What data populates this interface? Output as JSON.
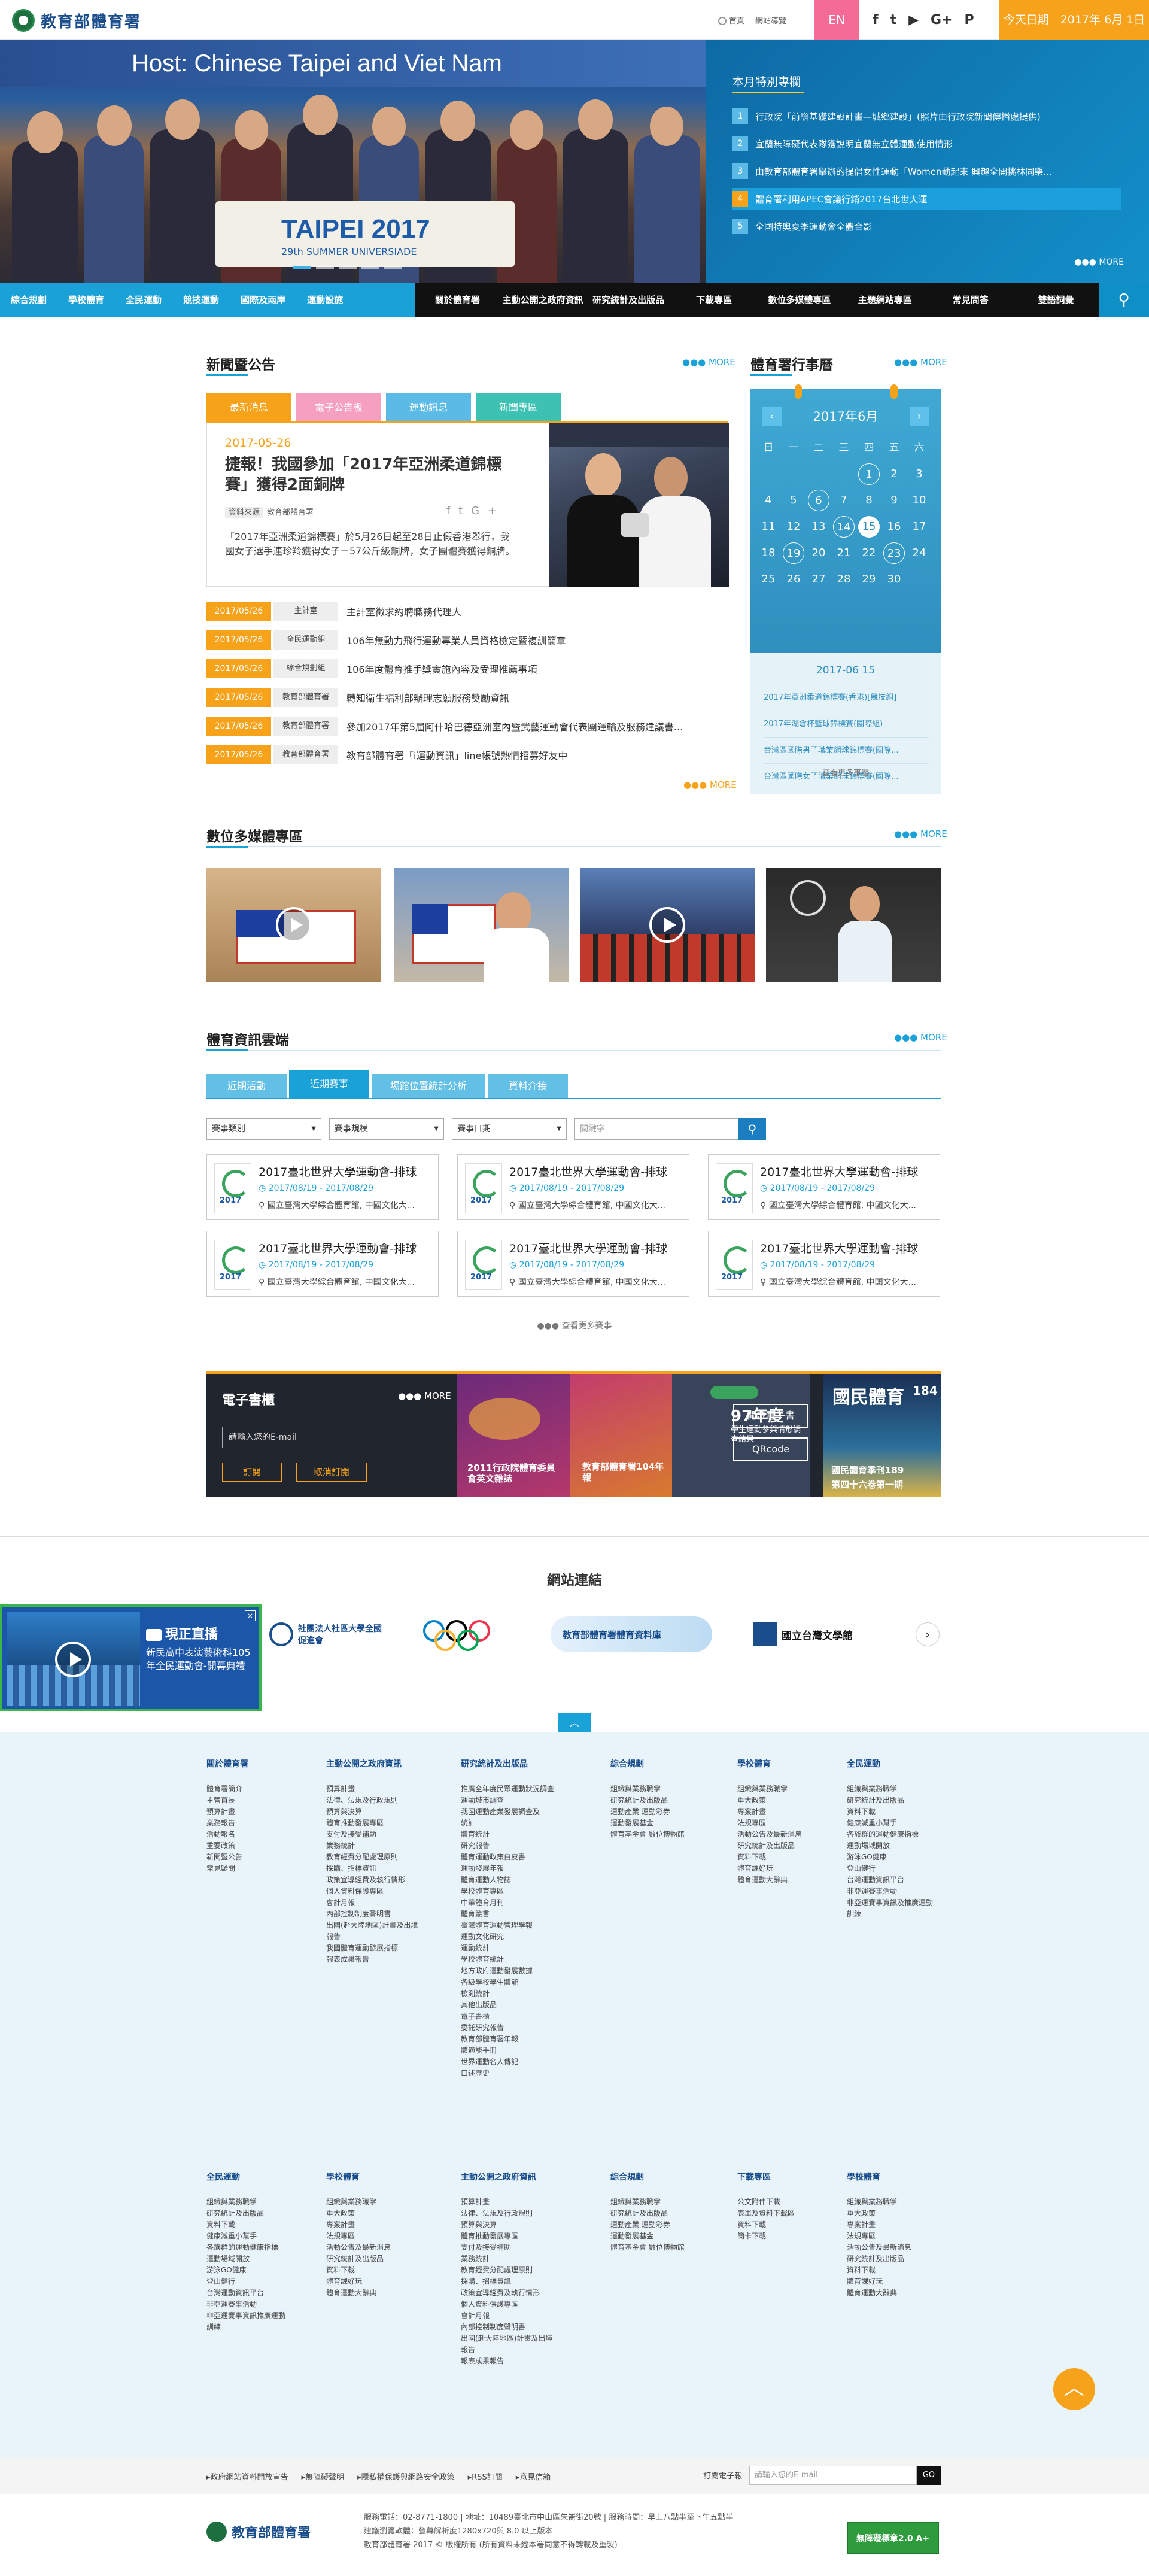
{
  "header": {
    "site_name": "教育部體育署",
    "links": [
      "首頁",
      "網站導覽"
    ],
    "lang": "EN",
    "social": [
      "f",
      "t",
      "▶",
      "G+",
      "P"
    ],
    "today": "今天日期　2017年 6月 1日"
  },
  "hero": {
    "sign_text": "Host: Chinese Taipei and Viet Nam",
    "banner_text": "TAIPEI 2017",
    "banner_sub": "29th SUMMER UNIVERSIADE",
    "special_title": "本月特別專欄",
    "special_items": [
      {
        "num": "1",
        "text": "行政院「前瞻基礎建設計畫—城鄉建設」(照片由行政院新聞傳播處提供)"
      },
      {
        "num": "2",
        "text": "宜蘭無障礙代表隊獲說明宜蘭無立體運動使用情形"
      },
      {
        "num": "3",
        "text": "由教育部體育署舉辦的提倡女性運動「Women動起來 興趣全開挑林同樂..."
      },
      {
        "num": "4",
        "text": "體育署利用APEC會議行銷2017台北世大運"
      },
      {
        "num": "5",
        "text": "全國特奧夏季運動會全體合影"
      }
    ],
    "special_more": "●●● MORE"
  },
  "nav": {
    "primary": [
      "綜合規劃",
      "學校體育",
      "全民運動",
      "競技運動",
      "國際及兩岸",
      "運動設施"
    ],
    "secondary": [
      "關於體育署",
      "主動公開之政府資訊",
      "研究統計及出版品",
      "下載專區",
      "數位多媒體專區",
      "主題網站專區",
      "常見問答",
      "雙語詞彙"
    ],
    "search_icon": "search-icon"
  },
  "news": {
    "title": "新聞暨公告",
    "more": "●●● MORE",
    "tabs": [
      {
        "label": "最新消息",
        "color": "#f7a21b"
      },
      {
        "label": "電子公告板",
        "color": "#f6a0c0"
      },
      {
        "label": "運動訊息",
        "color": "#5bbbe6"
      },
      {
        "label": "新聞專區",
        "color": "#3cc1b2"
      }
    ],
    "feature": {
      "date": "2017-05-26",
      "title": "捷報！我國參加「2017年亞洲柔道錦標賽」獲得2面銅牌",
      "tag": "資料來源",
      "source": "教育部體育署",
      "summary": "「2017年亞洲柔道錦標賽」於5月26日起至28日止假香港舉行，我國女子選手連珍羚獲得女子－57公斤級銅牌，女子團體賽獲得銅牌。"
    },
    "items": [
      {
        "date": "2017/05/26",
        "cat": "主計室",
        "text": "主計室徵求約聘職務代理人"
      },
      {
        "date": "2017/05/26",
        "cat": "全民運動組",
        "text": "106年無動力飛行運動專業人員資格檢定暨複訓簡章"
      },
      {
        "date": "2017/05/26",
        "cat": "綜合規劃組",
        "text": "106年度體育推手獎實施內容及受理推薦事項"
      },
      {
        "date": "2017/05/26",
        "cat": "教育部體育署",
        "text": "轉知衛生福利部辦理志願服務獎勵資訊"
      },
      {
        "date": "2017/05/26",
        "cat": "教育部體育署",
        "text": "參加2017年第5屆阿什哈巴德亞洲室內暨武藝運動會代表團運輸及服務建議書..."
      },
      {
        "date": "2017/05/26",
        "cat": "教育部體育署",
        "text": "教育部體育署「i運動資訊」line帳號熱情招募好友中"
      }
    ],
    "bottom_more": "●●● MORE"
  },
  "calendar": {
    "title": "體育署行事曆",
    "more": "●●● MORE",
    "month": "2017年6月",
    "weekdays": [
      "日",
      "一",
      "二",
      "三",
      "四",
      "五",
      "六"
    ],
    "days": [
      "",
      "",
      "",
      "",
      "1",
      "2",
      "3",
      "4",
      "5",
      "6",
      "7",
      "8",
      "9",
      "10",
      "11",
      "12",
      "13",
      "14",
      "15",
      "16",
      "17",
      "18",
      "19",
      "20",
      "21",
      "22",
      "23",
      "24",
      "25",
      "26",
      "27",
      "28",
      "29",
      "30",
      ""
    ],
    "circled": [
      "1",
      "6",
      "14",
      "19",
      "23"
    ],
    "today": "15",
    "selected_date": "2017-06 15",
    "events": [
      "2017年亞洲柔道錦標賽(香港)[競技組]",
      "2017年湖倉杯籃球錦標賽(國際組)",
      "台灣區國際男子職業網球錦標賽(國際...",
      "台灣區國際女子職業網球錦標賽(國際..."
    ],
    "see_more": "查看更多事曆"
  },
  "media": {
    "title": "數位多媒體專區",
    "more": "●●● MORE"
  },
  "sports_info": {
    "title": "體育資訊雲端",
    "more": "●●● MORE",
    "tabs": [
      "近期活動",
      "近期賽事",
      "場館位置統計分析",
      "資料介接"
    ],
    "filters": [
      "賽事類別",
      "賽事規模",
      "賽事日期"
    ],
    "keyword_placeholder": "關鍵字",
    "events": [
      {
        "title": "2017臺北世界大學運動會-排球",
        "date": "2017/08/19 - 2017/08/29",
        "place": "國立臺灣大學綜合體育館, 中國文化大..."
      },
      {
        "title": "2017臺北世界大學運動會-排球",
        "date": "2017/08/19 - 2017/08/29",
        "place": "國立臺灣大學綜合體育館, 中國文化大..."
      },
      {
        "title": "2017臺北世界大學運動會-排球",
        "date": "2017/08/19 - 2017/08/29",
        "place": "國立臺灣大學綜合體育館, 中國文化大..."
      },
      {
        "title": "2017臺北世界大學運動會-排球",
        "date": "2017/08/19 - 2017/08/29",
        "place": "國立臺灣大學綜合體育館, 中國文化大..."
      },
      {
        "title": "2017臺北世界大學運動會-排球",
        "date": "2017/08/19 - 2017/08/29",
        "place": "國立臺灣大學綜合體育館, 中國文化大..."
      },
      {
        "title": "2017臺北世界大學運動會-排球",
        "date": "2017/08/19 - 2017/08/29",
        "place": "國立臺灣大學綜合體育館, 中國文化大..."
      }
    ],
    "see_more": "●●● 查看更多賽事"
  },
  "ebook": {
    "title": "電子書櫃",
    "more": "●●● MORE",
    "email_placeholder": "請輸入您的E-mail",
    "subscribe": "訂閱",
    "unsubscribe": "取消訂閱",
    "book1": "2011行政院體育委員會英文雜誌",
    "book2": "教育部體育署104年報",
    "book3_big": "97年度",
    "book3_small": "學生運動參與情形調查結果",
    "btn_open": "開啟電子書",
    "btn_qr": "QRcode",
    "book4_title": "國民體育季刊189",
    "book4_sub": "第四十六卷第一期",
    "book4_num": "184"
  },
  "links": {
    "title": "網站連結",
    "live_title": "現正直播",
    "live_desc": "新民高中表演藝術科105年全民運動會-開幕典禮",
    "partners": [
      "社團法人社區大學全國促進會",
      "教育部體育署體育資料庫",
      "國立台灣文學館"
    ],
    "top_arrow": "︿"
  },
  "sitemap": {
    "columns": [
      {
        "title": "關於體育署",
        "items": [
          "體育署簡介",
          "主管首長",
          "預算計畫",
          "業務報告",
          "活動報名",
          "重要政策",
          "新聞暨公告",
          "常見疑問"
        ]
      },
      {
        "title": "主動公開之政府資訊",
        "items": [
          "預算計畫",
          "法律、法規及行政規則",
          "預算與決算",
          "體育推動發展專區",
          "支付及接受補助",
          "業務統計",
          "教育經費分配處理原則",
          "採購、招標資訊",
          "政策宣導經費及執行情形",
          "個人資料保護專區",
          "會計月報",
          "內部控制制度聲明書",
          "出國(赴大陸地區)計畫及出境",
          "報告",
          "我國體育運動發展指標",
          "報表成果報告"
        ]
      },
      {
        "title": "研究統計及出版品",
        "items": [
          "推廣全年度民眾運動狀況調查",
          "運動城市調查",
          "我國運動產業發展調查及",
          "統計",
          "體育統計",
          "研究報告",
          "體育運動政策白皮書",
          "運動發展年報",
          "體育運動人物誌",
          "學校體育專區",
          "中華體育月刊",
          "體育叢書",
          "臺灣體育運動管理學報",
          "運動文化研究",
          "運動統計",
          "學校體育統計",
          "地方政府運動發展數據",
          "各級學校學生體能",
          "檢測統計",
          "其他出版品",
          "電子書櫃",
          "委託研究報告",
          "教育部體育署年報",
          "體適能手冊",
          "世界運動名人傳記",
          "口述歷史"
        ]
      },
      {
        "title": "綜合規劃",
        "items": [
          "組織與業務職掌",
          "研究統計及出版品",
          "運動產業 運動彩券",
          "運動發展基金",
          "體育基金會 數位博物館"
        ]
      },
      {
        "title": "學校體育",
        "items": [
          "組織與業務職掌",
          "重大政策",
          "專案計畫",
          "法規專區",
          "活動公告及最新消息",
          "研究統計及出版品",
          "資料下載",
          "體育課好玩",
          "體育運動大辭典"
        ]
      },
      {
        "title": "全民運動",
        "items": [
          "組織與業務職掌",
          "研究統計及出版品",
          "資料下載",
          "健康減重小幫手",
          "各族群的運動健康指標",
          "運動場域開放",
          "游泳GO健康",
          "登山健行",
          "台灣運動資訊平台",
          "非亞運賽事活動",
          "非亞運賽事資訊及推廣運動",
          "訓練"
        ]
      },
      {
        "title": "全民運動",
        "items": [
          "組織與業務職掌",
          "研究統計及出版品",
          "資料下載",
          "健康減重小幫手",
          "各族群的運動健康指標",
          "運動場域開放",
          "游泳GO健康",
          "登山健行",
          "台灣運動資訊平台",
          "非亞運賽事活動",
          "非亞運賽事資訊推廣運動",
          "訓練"
        ]
      },
      {
        "title": "學校體育",
        "items": [
          "組織與業務職掌",
          "重大政策",
          "專案計畫",
          "法規專區",
          "活動公告及最新消息",
          "研究統計及出版品",
          "資料下載",
          "體育課好玩",
          "體育運動大辭典"
        ]
      },
      {
        "title": "主動公開之政府資訊",
        "items": [
          "預算計畫",
          "法律、法規及行政規則",
          "預算與決算",
          "體育推動發展專區",
          "支付及接受補助",
          "業務統計",
          "教育經費分配處理原則",
          "採購、招標資訊",
          "政策宣導經費及執行情形",
          "個人資料保護專區",
          "會計月報",
          "內部控制制度聲明書",
          "出國(赴大陸地區)計畫及出境",
          "報告",
          "報表成果報告"
        ]
      },
      {
        "title": "綜合規劃",
        "items": [
          "組織與業務職掌",
          "研究統計及出版品",
          "運動產業 運動彩券",
          "運動發展基金",
          "體育基金會 數位博物館"
        ]
      },
      {
        "title": "下載專區",
        "items": [
          "公文附件下載",
          "表單及資料下載區",
          "資料下載",
          "簡卡下載"
        ]
      },
      {
        "title": "學校體育",
        "items": [
          "組織與業務職掌",
          "重大政策",
          "專案計畫",
          "法規專區",
          "活動公告及最新消息",
          "研究統計及出版品",
          "資料下載",
          "體育課好玩",
          "體育運動大辭典"
        ]
      }
    ],
    "gotop": "︿"
  },
  "footer": {
    "links": [
      "政府網站資料開放宣告",
      "無障礙聲明",
      "隱私權保護與網路安全政策",
      "RSS訂閱",
      "意見信箱"
    ],
    "subscribe_label": "訂閱電子報",
    "subscribe_placeholder": "請輸入您的E-mail",
    "go": "GO",
    "info_lines": [
      "服務電話：02-8771-1800 | 地址：10489臺北市中山區朱崙街20號 | 服務時間：早上八點半至下午五點半",
      "建議瀏覽軟體：螢幕解析度1280x720與 8.0 以上版本",
      "教育部體育署 2017 © 版權所有 (所有資料未經本署同意不得轉載及重製)"
    ],
    "accessibility": "無障礙標章2.0 A+"
  }
}
